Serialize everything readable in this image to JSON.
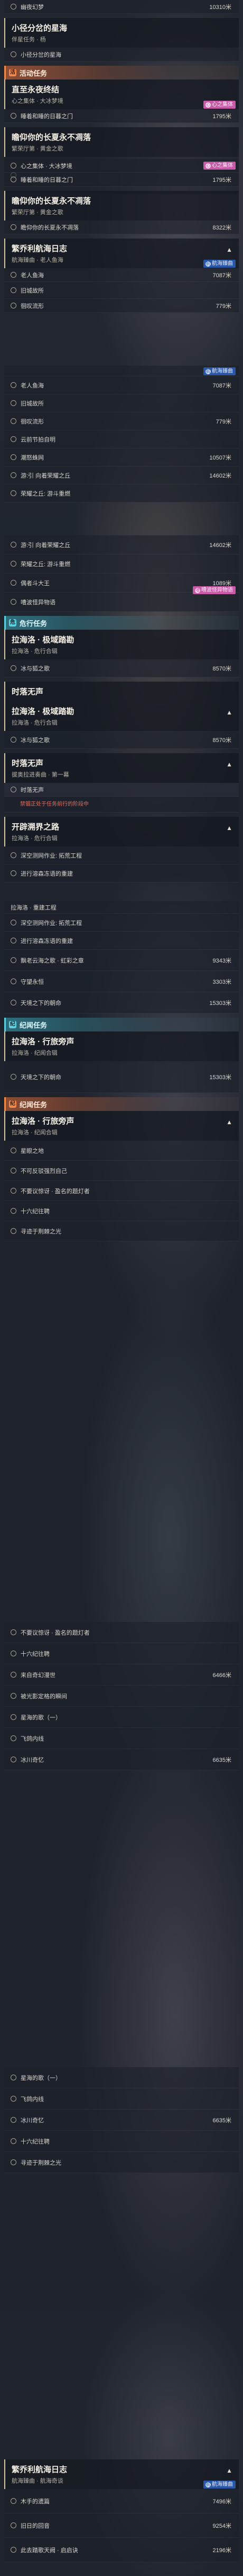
{
  "s1": {
    "rows": [
      {
        "label": "幽夜幻梦",
        "dist": "10310米"
      }
    ],
    "head": {
      "title": "小径分岔的星海",
      "sub": "伴星任务 · 杨"
    },
    "rows2": [
      {
        "label": "小径分岔的星海",
        "dist": ""
      }
    ]
  },
  "cat1": {
    "icon": "活",
    "label": "活动任务"
  },
  "s2": {
    "head": {
      "title": "直至永夜终结",
      "sub": "心之集体 · 大冰梦境"
    },
    "tag": {
      "icon": "心",
      "label": "心之集体"
    },
    "rows": [
      {
        "label": "睡着和睡的日暮之门",
        "dist": "1795米"
      }
    ]
  },
  "s3": {
    "head": {
      "title": "瞻仰你的长夏永不凋落",
      "sub": "繁荣厅第 · 黄金之歌"
    },
    "rows": [
      {
        "label": "心之集体 · 大冰梦境",
        "dist": ""
      },
      {
        "label": "睡着和睡的日暮之门",
        "dist": "1795米"
      },
      {
        "label": "",
        "dist": ""
      }
    ],
    "tag": {
      "icon": "心",
      "label": "心之集体"
    }
  },
  "s4": {
    "head": {
      "title": "瞻仰你的长夏永不凋落",
      "sub": "繁荣厅第 · 黄金之歌"
    },
    "rows": [
      {
        "label": "瞻仰你的长夏永不凋落",
        "dist": "8322米"
      }
    ]
  },
  "s5": {
    "head": {
      "title": "繁乔利航海日志",
      "sub": "航海臻曲 · 老人鱼海"
    },
    "tag": {
      "icon": "航",
      "label": "航海臻曲"
    },
    "rows": [
      {
        "label": "老人鱼海",
        "dist": "7087米"
      },
      {
        "label": "旧城故所",
        "dist": ""
      },
      {
        "label": "徊叹流形",
        "dist": "779米"
      }
    ]
  },
  "s6": {
    "tag": {
      "icon": "航",
      "label": "航海臻曲"
    },
    "rows": [
      {
        "label": "老人鱼海",
        "dist": "7087米"
      },
      {
        "label": "旧城故所",
        "dist": ""
      },
      {
        "label": "徊叹流形",
        "dist": "779米"
      },
      {
        "label": "云前节拍自明",
        "dist": ""
      },
      {
        "label": "潮怒蛛网",
        "dist": "10507米"
      },
      {
        "label": "游:引 向着荣耀之丘",
        "dist": "14602米"
      },
      {
        "label": "荣耀之丘: 游斗重燃",
        "dist": ""
      }
    ]
  },
  "s7": {
    "rows": [
      {
        "label": "游:引 向着荣耀之丘",
        "dist": "14602米"
      },
      {
        "label": "荣耀之丘: 游斗重燃",
        "dist": ""
      },
      {
        "label": "偶者斗大王",
        "dist": "1089米"
      },
      {
        "label": "嘈波怪异物语",
        "dist": ""
      }
    ],
    "tag": {
      "icon": "嘈",
      "label": "嘈波怪异物语"
    }
  },
  "cat2": {
    "icon": "危",
    "label": "危行任务"
  },
  "s8": {
    "head": {
      "title": "拉海洛 · 极域踏勘",
      "sub": "拉海洛 · 危行合辑"
    },
    "rows": [
      {
        "label": "冰与狐之歌",
        "dist": "8570米"
      }
    ]
  },
  "s9": {
    "head": {
      "title": "时落无声",
      "sub": ""
    },
    "head2": {
      "title": "拉海洛 · 极域踏勘",
      "sub": "拉海洛 · 危行合辑"
    },
    "rows": [
      {
        "label": "冰与狐之歌",
        "dist": "8570米"
      }
    ]
  },
  "s10": {
    "head": {
      "title": "时落无声",
      "sub": "拔奥拉进奏曲 · 第一幕"
    },
    "rows": [
      {
        "label": "时落无声",
        "dist": ""
      }
    ],
    "note": "禁锢正处于任务前行的阶段中"
  },
  "s11": {
    "head": {
      "title": "开辟溯界之路",
      "sub": "拉海洛 · 危行合辑"
    },
    "rows": [
      {
        "label": "深空测网作业: 拓荒工程",
        "dist": ""
      },
      {
        "label": "进行溶森冻语的重建",
        "dist": ""
      }
    ]
  },
  "s12": {
    "rows": [
      {
        "label": "拉海洛 · 重建工程",
        "dist": ""
      },
      {
        "label": "深空测网作业: 拓荒工程",
        "dist": ""
      },
      {
        "label": "进行溶森冻语的重建",
        "dist": ""
      },
      {
        "label": "飘老云海之歌 · 虹彩之章",
        "dist": "9343米"
      },
      {
        "label": "守望永恒",
        "dist": "3303米"
      },
      {
        "label": "天境之下的朝命",
        "dist": "15303米"
      }
    ]
  },
  "cat3": {
    "icon": "纪",
    "label": "纪闻任务"
  },
  "s13": {
    "head": {
      "title": "拉海洛 · 行旅旁声",
      "sub": "拉海洛 · 纪闻合辑"
    },
    "rows": [
      {
        "label": "天境之下的朝命",
        "dist": "15303米"
      }
    ]
  },
  "cat4": {
    "icon": "纪",
    "label": "纪闻任务"
  },
  "s14": {
    "head": {
      "title": "拉海洛 · 行旅旁声",
      "sub": "拉海洛 · 纪闻合辑"
    },
    "rows": [
      {
        "label": "星眼之地",
        "dist": ""
      },
      {
        "label": "不可反驳强烈自己",
        "dist": ""
      },
      {
        "label": "不要议惊讶 · 盈名的题灯者",
        "dist": ""
      },
      {
        "label": "十六纪往聘",
        "dist": ""
      },
      {
        "label": "寻迹于荆棘之光",
        "dist": ""
      },
      {
        "label": "不要议惊讶 · 盈名的题灯者",
        "dist": ""
      },
      {
        "label": "十六纪往聘",
        "dist": ""
      },
      {
        "label": "来自奇幻漫世",
        "dist": "6466米"
      },
      {
        "label": "被光影定格的瞬间",
        "dist": ""
      },
      {
        "label": "星海的歌（一）",
        "dist": ""
      },
      {
        "label": "飞鸽内线",
        "dist": ""
      },
      {
        "label": "冰川奇忆",
        "dist": "6635米"
      }
    ]
  },
  "s15": {
    "rows": [
      {
        "label": "星海的歌（一）",
        "dist": ""
      },
      {
        "label": "飞鸽内线",
        "dist": ""
      },
      {
        "label": "冰川奇忆",
        "dist": "6635米"
      },
      {
        "label": "十六纪往聘",
        "dist": ""
      },
      {
        "label": "寻迹于荆棘之光",
        "dist": ""
      }
    ]
  },
  "s16": {
    "head": {
      "title": "繁乔利航海日志",
      "sub": "航海臻曲 · 航海奇谈"
    },
    "tag": {
      "icon": "航",
      "label": "航海臻曲"
    },
    "rows": [
      {
        "label": "木手的遗篇",
        "dist": "7496米"
      },
      {
        "label": "旧日的回音",
        "dist": "9254米"
      },
      {
        "label": "此去踏歌天阙 · 启启诀",
        "dist": "2196米"
      }
    ]
  }
}
